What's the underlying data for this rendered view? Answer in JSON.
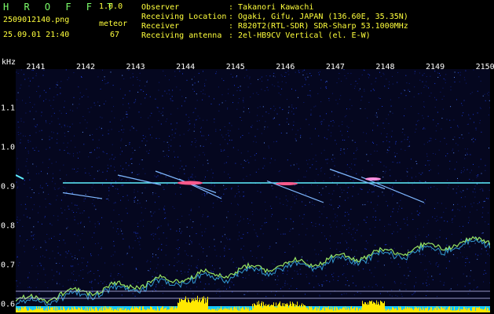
{
  "app": {
    "title": "H R O F F T",
    "version": "1.0.0"
  },
  "capture": {
    "filename": "2509012140.png",
    "datetime": "25.09.01 21:40",
    "meteor_label": "meteor",
    "meteor_count": "67"
  },
  "info": [
    {
      "label": "Observer",
      "value": ": Takanori Kawachi"
    },
    {
      "label": "Receiving Location",
      "value": ": Ogaki, Gifu, JAPAN (136.60E, 35.35N)"
    },
    {
      "label": "Receiver",
      "value": ": R820T2(RTL-SDR) SDR-Sharp 53.1000MHz"
    },
    {
      "label": "Receiving antenna",
      "value": ": 2el-HB9CV Vertical (el. E-W)"
    }
  ],
  "spectrogram": {
    "y_unit": "kHz",
    "time_ticks": [
      "2141",
      "2142",
      "2143",
      "2144",
      "2145",
      "2146",
      "2147",
      "2148",
      "2149",
      "2150"
    ],
    "freq_ticks": [
      "1.1",
      "1.0",
      "0.9",
      "0.8",
      "0.7",
      "0.6"
    ],
    "freq_values": [
      1.1,
      1.0,
      0.9,
      0.8,
      0.7,
      0.6
    ],
    "y_range_khz": [
      0.58,
      1.2
    ],
    "x_range_min": [
      2140.6,
      2150.1
    ],
    "carrier_khz": 0.91,
    "colors": {
      "background": "#05071f",
      "noise": "#1c3bd6",
      "carrier": "#5ff0ff",
      "echo": "#ff5a8c",
      "drift": "#a8ff6a",
      "level": "#ffe800",
      "level_base": "#16c8ff"
    }
  }
}
